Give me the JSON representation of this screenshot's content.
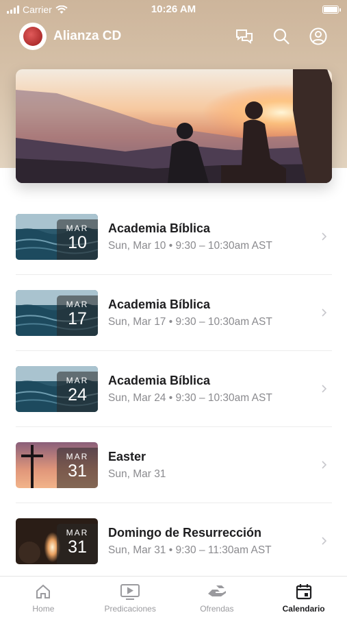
{
  "status_bar": {
    "carrier": "Carrier",
    "time": "10:26 AM"
  },
  "header": {
    "title": "Alianza CD",
    "icons": [
      "chat-icon",
      "search-icon",
      "profile-icon"
    ]
  },
  "hero": {
    "image": "people-watching-sunset"
  },
  "events": [
    {
      "month": "MAR",
      "day": "10",
      "title": "Academia Bíblica",
      "subtitle": "Sun, Mar 10 • 9:30 – 10:30am AST",
      "thumb": "ocean-waves"
    },
    {
      "month": "MAR",
      "day": "17",
      "title": "Academia Bíblica",
      "subtitle": "Sun, Mar 17 • 9:30 – 10:30am AST",
      "thumb": "ocean-waves"
    },
    {
      "month": "MAR",
      "day": "24",
      "title": "Academia Bíblica",
      "subtitle": "Sun, Mar 24 • 9:30 – 10:30am AST",
      "thumb": "ocean-waves"
    },
    {
      "month": "MAR",
      "day": "31",
      "title": "Easter",
      "subtitle": "Sun, Mar 31",
      "thumb": "cross-sunset"
    },
    {
      "month": "MAR",
      "day": "31",
      "title": "Domingo de Resurrección",
      "subtitle": "Sun, Mar 31 • 9:30 – 11:30am AST",
      "thumb": "empty-tomb"
    }
  ],
  "tabs": [
    {
      "label": "Home",
      "icon": "home-icon",
      "active": false
    },
    {
      "label": "Predicaciones",
      "icon": "video-icon",
      "active": false
    },
    {
      "label": "Ofrendas",
      "icon": "giving-icon",
      "active": false
    },
    {
      "label": "Calendario",
      "icon": "calendar-icon",
      "active": true
    }
  ],
  "colors": {
    "header_bg": "#cdb59b",
    "accent": "#1d1d1f",
    "muted": "#8a8a8e"
  }
}
